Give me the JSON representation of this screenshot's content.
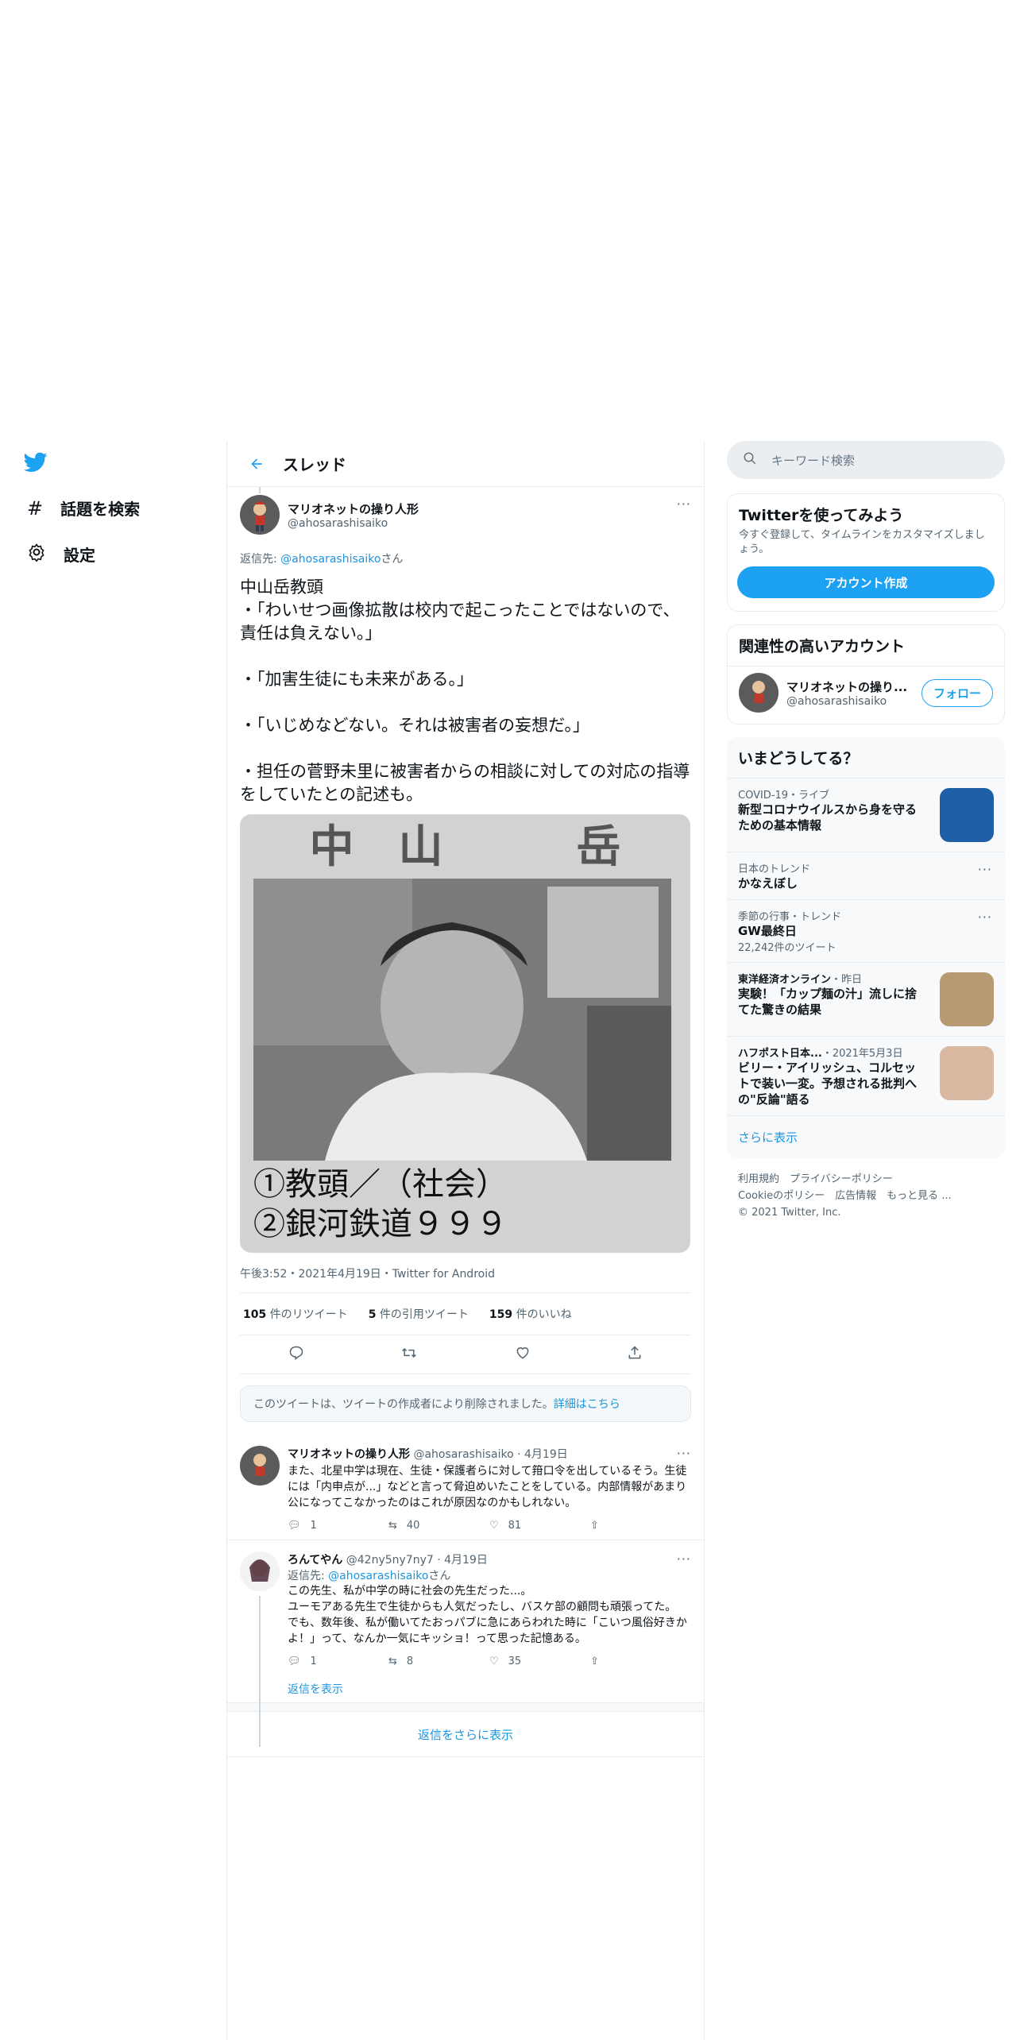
{
  "nav": {
    "items": [
      {
        "label": "話題を検索",
        "icon": "hashtag-icon"
      },
      {
        "label": "設定",
        "icon": "gear-icon"
      }
    ]
  },
  "header": {
    "title": "スレッド"
  },
  "main_tweet": {
    "name": "マリオネットの操り人形",
    "handle": "@ahosarashisaiko",
    "reply_prefix": "返信先: ",
    "reply_handle": "@ahosarashisaiko",
    "reply_suffix": "さん",
    "text": "中山岳教頭\n・「わいせつ画像拡散は校内で起こったことではないので、責任は負えない。」\n\n・「加害生徒にも未来がある。」\n\n・「いじめなどない。それは被害者の妄想だ。」\n\n・担任の菅野未里に被害者からの相談に対しての対応の指導をしていたとの記述も。",
    "media": {
      "title": "中　山　　　岳",
      "line1": "①教頭／（社会）",
      "line2": "②銀河鉄道９９９"
    },
    "meta": "午後3:52・2021年4月19日・Twitter for Android",
    "stats": {
      "retweets": "105",
      "retweets_label": " 件のリツイート",
      "quotes": "5",
      "quotes_label": " 件の引用ツイート",
      "likes": "159",
      "likes_label": " 件のいいね"
    }
  },
  "deleted_notice": {
    "text": "このツイートは、ツイートの作成者により削除されました。",
    "link": "詳細はこちら"
  },
  "replies": [
    {
      "name": "マリオネットの操り人形",
      "handle_date": "@ahosarashisaiko · 4月19日",
      "text": "また、北星中学は現在、生徒・保護者らに対して箝口令を出しているそう。生徒には「内申点が...」などと言って脅迫めいたことをしている。内部情報があまり公になってこなかったのはこれが原因なのかもしれない。",
      "replies": "1",
      "retweets": "40",
      "likes": "81"
    },
    {
      "name": "ろんてやん",
      "handle_date": "@42ny5ny7ny7 · 4月19日",
      "reply_prefix": "返信先: ",
      "reply_handle": "@ahosarashisaiko",
      "reply_suffix": "さん",
      "text": "この先生、私が中学の時に社会の先生だった...。\nユーモアある先生で生徒からも人気だったし、バスケ部の顧問も頑張ってた。\nでも、数年後、私が働いてたおっパブに急にあらわれた時に「こいつ風俗好きかよ！」って、なんか一気にキッショ！って思った記憶ある。",
      "replies": "1",
      "retweets": "8",
      "likes": "35",
      "show_replies": "返信を表示"
    }
  ],
  "more_replies": "返信をさらに表示",
  "sidebar": {
    "search_placeholder": "キーワード検索",
    "signup": {
      "title": "Twitterを使ってみよう",
      "desc": "今すぐ登録して、タイムラインをカスタマイズしましょう。",
      "button": "アカウント作成"
    },
    "related": {
      "title": "関連性の高いアカウント",
      "name": "マリオネットの操り...",
      "handle": "@ahosarashisaiko",
      "follow": "フォロー"
    },
    "trends": {
      "title": "いまどうしてる？",
      "items": [
        {
          "context": "COVID-19・ライブ",
          "title": "新型コロナウイルスから身を守るための基本情報"
        },
        {
          "context": "日本のトレンド",
          "title": "かなえぼし"
        },
        {
          "context": "季節の行事・トレンド",
          "title": "GW最終日",
          "count": "22,242件のツイート"
        },
        {
          "context": "東洋経済オンライン",
          "context_extra": "・昨日",
          "title": "実験！「カップ麺の汁」流しに捨てた驚きの結果"
        },
        {
          "context": "ハフポスト日本...",
          "context_extra": "・2021年5月3日",
          "title": "ビリー・アイリッシュ、コルセットで装い一変。予想される批判への\"反論\"語る"
        }
      ],
      "show_more": "さらに表示"
    },
    "footer": {
      "line1": "利用規約　プライバシーポリシー",
      "line2": "Cookieのポリシー　広告情報　もっと見る ...",
      "line3": "© 2021 Twitter, Inc."
    }
  },
  "colors": {
    "accent": "#1da1f2",
    "text": "#0f1419",
    "muted": "#536471",
    "border": "#e6ecf0"
  }
}
